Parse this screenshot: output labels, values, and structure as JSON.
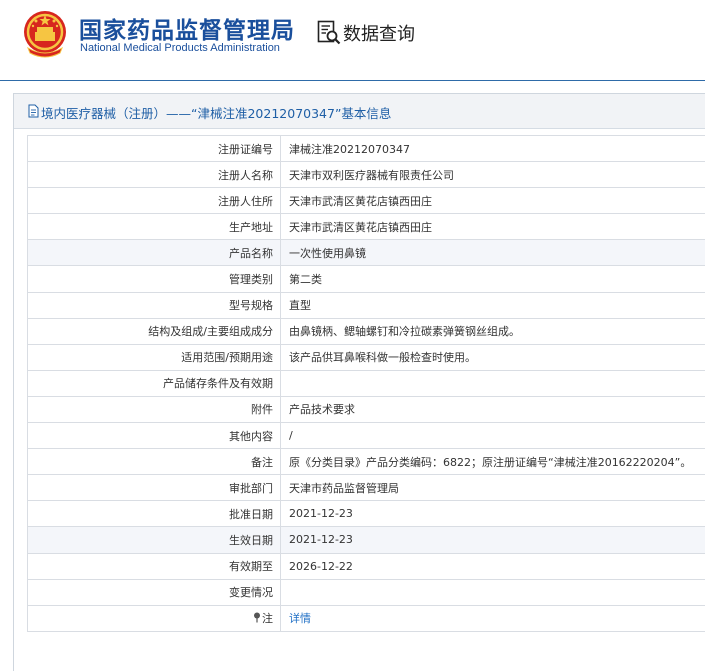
{
  "header": {
    "site_title": "国家药品监督管理局",
    "site_subtitle": "National Medical Products Administration",
    "query_title": "数据查询",
    "emblem_icon": "national-emblem-icon",
    "query_icon": "document-search-icon",
    "brand_color": "#1a4f9c"
  },
  "panel": {
    "title": "境内医疗器械（注册）——“津械注准20212070347”基本信息",
    "title_icon": "document-icon"
  },
  "rows": [
    {
      "label": "注册证编号",
      "value": "津械注准20212070347"
    },
    {
      "label": "注册人名称",
      "value": "天津市双利医疗器械有限责任公司"
    },
    {
      "label": "注册人住所",
      "value": "天津市武清区黄花店镇西田庄"
    },
    {
      "label": "生产地址",
      "value": "天津市武清区黄花店镇西田庄"
    },
    {
      "label": "产品名称",
      "value": "一次性使用鼻镜"
    },
    {
      "label": "管理类别",
      "value": "第二类"
    },
    {
      "label": "型号规格",
      "value": "直型"
    },
    {
      "label": "结构及组成/主要组成成分",
      "value": "由鼻镜柄、鳃轴螺钉和冷拉碳素弹簧钢丝组成。"
    },
    {
      "label": "适用范围/预期用途",
      "value": "该产品供耳鼻喉科做一般检查时使用。"
    },
    {
      "label": "产品储存条件及有效期",
      "value": ""
    },
    {
      "label": "附件",
      "value": "产品技术要求"
    },
    {
      "label": "其他内容",
      "value": "/"
    },
    {
      "label": "备注",
      "value": "原《分类目录》产品分类编码：6822；原注册证编号“津械注准20162220204”。"
    },
    {
      "label": "审批部门",
      "value": "天津市药品监督管理局"
    },
    {
      "label": "批准日期",
      "value": "2021-12-23"
    },
    {
      "label": "生效日期",
      "value": "2021-12-23"
    },
    {
      "label": "有效期至",
      "value": "2026-12-22"
    },
    {
      "label": "变更情况",
      "value": ""
    }
  ],
  "note_row": {
    "label": "注",
    "link_text": "详情",
    "icon": "pin-icon",
    "link_color": "#1f6fc5"
  }
}
